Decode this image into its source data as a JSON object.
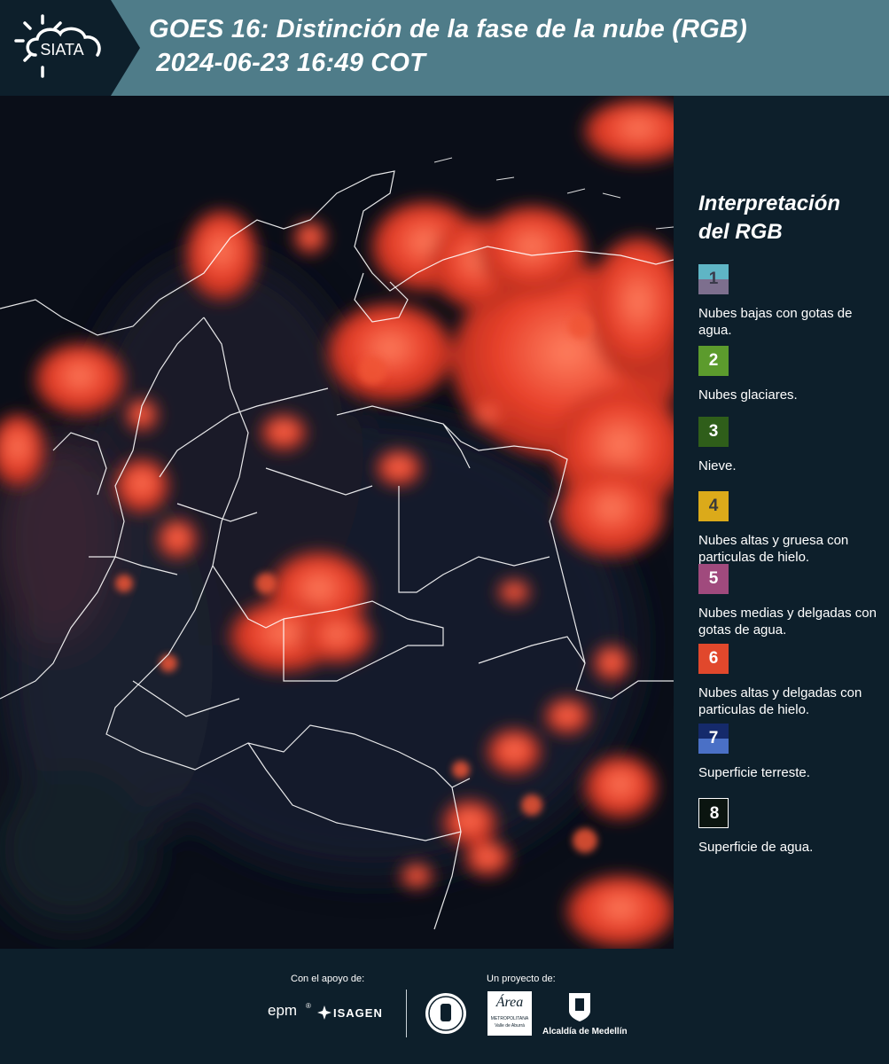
{
  "header": {
    "logo_text": "SIATA",
    "title_line1": "GOES 16: Distinción de la fase de la nube (RGB)",
    "title_line2": " 2024-06-23 16:49 COT"
  },
  "legend": {
    "title": "Interpretación del RGB",
    "items": [
      {
        "num": "1",
        "label": "Nubes bajas con gotas de agua.",
        "color_top": "#5fb5c5",
        "color_bottom": "#7d6f8e",
        "num_color": "#3a3a4a"
      },
      {
        "num": "2",
        "label": "Nubes glaciares.",
        "color_top": "#5c9b2d",
        "color_bottom": "#5c9b2d",
        "num_color": "#ffffff"
      },
      {
        "num": "3",
        "label": "Nieve.",
        "color_top": "#2f5e1a",
        "color_bottom": "#2f5e1a",
        "num_color": "#ffffff"
      },
      {
        "num": "4",
        "label": "Nubes altas y gruesa con particulas de hielo.",
        "color_top": "#dbaa1a",
        "color_bottom": "#dbaa1a",
        "num_color": "#3a3a3a"
      },
      {
        "num": "5",
        "label": "Nubes medias y delgadas con gotas de agua.",
        "color_top": "#a04a7d",
        "color_bottom": "#a04a7d",
        "num_color": "#ffffff"
      },
      {
        "num": "6",
        "label": "Nubes altas y delgadas con particulas de hielo.",
        "color_top": "#e1482c",
        "color_bottom": "#e1482c",
        "num_color": "#ffffff"
      },
      {
        "num": "7",
        "label": "Superficie terreste.",
        "color_top": "#152a6b",
        "color_bottom": "#4a70c6",
        "num_color": "#ffffff"
      },
      {
        "num": "8",
        "label": "Superficie de agua.",
        "color_top": "#0b1510",
        "color_bottom": "#0b1510",
        "num_color": "#ffffff"
      }
    ]
  },
  "footer": {
    "support_label": "Con el apoyo de:",
    "project_label": "Un proyecto de:",
    "sponsor1": "epm",
    "sponsor2": "ISAGEN",
    "partner1": "Área",
    "partner1_sub": "METROPOLITANA",
    "partner1_sub2": "Valle de Aburrá",
    "partner2": "Alcaldía de Medellín"
  },
  "colors": {
    "header_bg": "#4f7c89",
    "logo_bg": "#0d1f2b",
    "page_bg": "#0d1f2b",
    "cloud_red": "#e8402a"
  }
}
